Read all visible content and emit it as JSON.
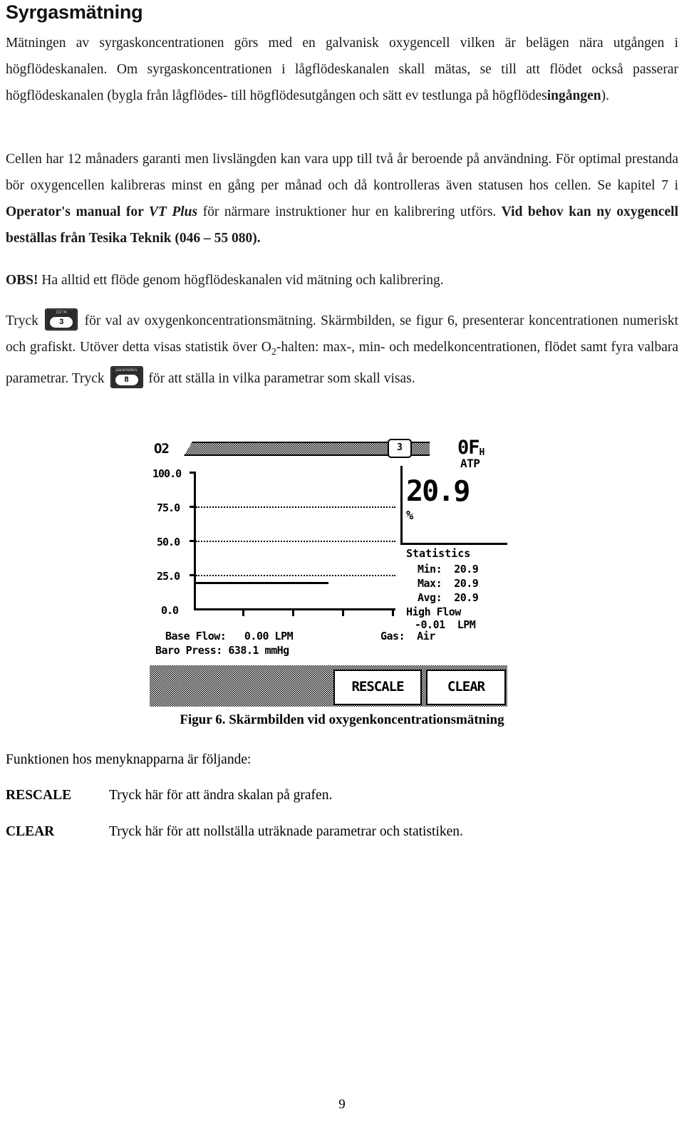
{
  "heading": "Syrgasmätning",
  "paragraphs": {
    "intro_1": "Mätningen av syrgaskoncentrationen görs med en galvanisk oxygencell vilken är belägen nära utgången i högflödeskanalen. ",
    "intro_2": "Om syrgaskoncentrationen i lågflödeskanalen skall mätas, se till att flödet också passerar högflödeskanalen (bygla från lågflödes- till högflödesutgången och sätt ev testlunga på högflödes",
    "intro_3_bold": "ingången",
    "intro_4": ").",
    "cell_1": "Cellen har 12 månaders garanti men livslängden kan vara upp till två år beroende på användning. För optimal prestanda bör oxygencellen kalibreras minst en gång per månad och då kontrolleras även statusen hos cellen. Se kapitel 7 i ",
    "cell_2_bold": "Operator's manual for ",
    "cell_3_bolditalic": "VT Plus",
    "cell_4": " för närmare instruktioner hur en kalibrering utförs. ",
    "cell_5_bold": "Vid behov kan ny oxygencell beställas från Tesika Teknik (046 – 55 080).",
    "obs_bold": "OBS!",
    "obs_text": " Ha alltid ett flöde genom högflödeskanalen vid mätning och kalibrering.",
    "press_1": "Tryck ",
    "press_2": " för val av oxygenkoncentrationsmätning. Skärmbilden, se figur 6, presenterar koncentrationen numeriskt och grafiskt. Utöver detta visas statistik över O",
    "press_2_sub": "2",
    "press_3": "-halten: max-, min- och medelkoncentrationen, flödet samt fyra valbara parametrar. Tryck ",
    "press_4": " för att ställa in vilka parametrar som skall visas."
  },
  "inline_buttons": [
    {
      "caption": "O2 %",
      "digit": "3"
    },
    {
      "caption": "parameters",
      "digit": "8"
    }
  ],
  "lcd": {
    "title": "O2",
    "header_chip": "3",
    "mode": "0F",
    "mode_sub": "H",
    "atp": "ATP",
    "big_value": "20.9",
    "big_unit": "%",
    "statistics_title": "Statistics",
    "statistics": [
      {
        "label": "Min:",
        "value": "20.9"
      },
      {
        "label": "Max:",
        "value": "20.9"
      },
      {
        "label": "Avg:",
        "value": "20.9"
      }
    ],
    "high_flow_label": "High Flow",
    "high_flow_value": "-0.01  LPM",
    "base_flow": "Base Flow:   0.00 LPM",
    "baro_press": "Baro Press: 638.1 mmHg",
    "gas": "Gas:  Air",
    "softkeys": [
      {
        "label": "RESCALE"
      },
      {
        "label": "CLEAR"
      }
    ]
  },
  "chart_data": {
    "type": "line",
    "title": "O2",
    "xlabel": "",
    "ylabel": "",
    "ylim": [
      0,
      100
    ],
    "yticks": [
      "100.0",
      "75.0",
      "50.0",
      "25.0",
      "0.0"
    ],
    "ytick_values": [
      100.0,
      75.0,
      50.0,
      25.0,
      0.0
    ],
    "grid": "dotted horizontal at 75.0, 50.0, 25.0",
    "legend": "none",
    "series": [
      {
        "name": "O2 concentration",
        "value": 20.9,
        "units": "%",
        "trace_extent_fraction": 0.66
      }
    ]
  },
  "caption": "Figur 6. Skärmbilden vid oxygenkoncentrationsmätning",
  "legend": {
    "intro": "Funktionen hos menyknapparna är följande:",
    "rows": [
      {
        "key": "RESCALE",
        "desc": "Tryck här för att ändra skalan på grafen."
      },
      {
        "key": "CLEAR",
        "desc": "Tryck här för att nollställa uträknade parametrar och statistiken."
      }
    ]
  },
  "page_number": "9"
}
